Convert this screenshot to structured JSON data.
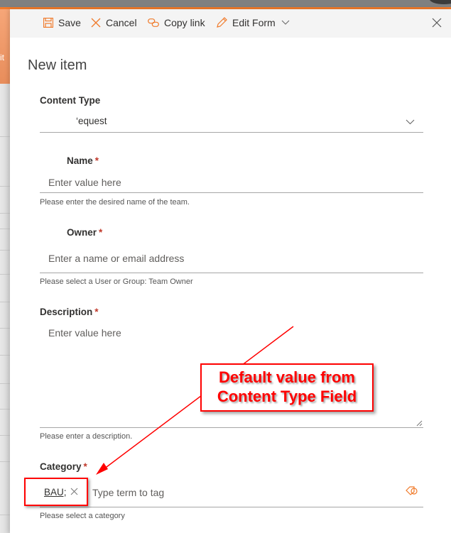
{
  "background": {
    "side_label": "it"
  },
  "toolbar": {
    "save_label": "Save",
    "cancel_label": "Cancel",
    "copy_link_label": "Copy link",
    "edit_form_label": "Edit Form"
  },
  "form": {
    "title": "New item",
    "content_type": {
      "label": "Content Type",
      "value": "‘equest"
    },
    "name": {
      "label": "Name",
      "required_mark": "*",
      "placeholder": "Enter value here",
      "help": "Please enter the desired name of the team."
    },
    "owner": {
      "label": "Owner",
      "required_mark": "*",
      "placeholder": "Enter a name or email address",
      "help": "Please select a User or Group: Team Owner"
    },
    "description": {
      "label": "Description",
      "required_mark": "*",
      "placeholder": "Enter value here",
      "help": "Please enter a description."
    },
    "category": {
      "label": "Category",
      "required_mark": "*",
      "tag_value": "BAU;",
      "placeholder": "Type term to tag",
      "help": "Please select a category"
    }
  },
  "annotation": {
    "line1": "Default value from",
    "line2": "Content Type Field"
  },
  "colors": {
    "accent": "#f07a2a",
    "annotation": "#ff0000",
    "required": "#c0392b"
  }
}
